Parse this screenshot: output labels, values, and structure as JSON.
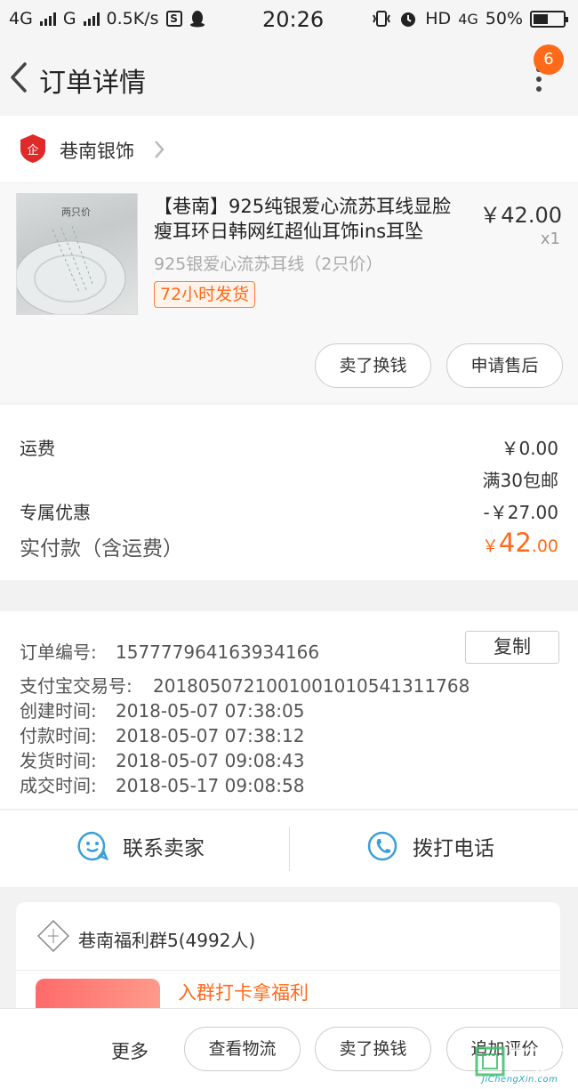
{
  "status_bar": {
    "network_1": "4G",
    "network_2": "G",
    "speed": "0.5K/s",
    "time": "20:26",
    "hd": "HD",
    "network_3": "4G",
    "battery": "50%",
    "battery_level": 0.5
  },
  "header": {
    "title": "订单详情",
    "badge_count": "6"
  },
  "shop": {
    "name": "巷南银饰"
  },
  "item": {
    "image_label": "两只价",
    "title": "【巷南】925纯银爱心流苏耳线显脸瘦耳环日韩网红超仙耳饰ins耳坠",
    "spec": "925银爱心流苏耳线（2只价）",
    "tag": "72小时发货",
    "price": "￥42.00",
    "qty": "x1",
    "buttons": [
      "卖了换钱",
      "申请售后"
    ]
  },
  "summary": {
    "shipping_label": "运费",
    "shipping_value": "￥0.00",
    "shipping_note": "满30包邮",
    "discount_label": "专属优惠",
    "discount_value": "-￥27.00",
    "paid_label": "实付款（含运费）",
    "paid_currency": "￥",
    "paid_int": "42",
    "paid_dec": ".00"
  },
  "order_info": {
    "copy_button": "复制",
    "rows": [
      {
        "label": "订单编号:",
        "value": "157777964163934166"
      },
      {
        "label": "支付宝交易号:",
        "value": "2018050721001001010541311768"
      },
      {
        "label": "创建时间:",
        "value": "2018-05-07 07:38:05"
      },
      {
        "label": "付款时间:",
        "value": "2018-05-07 07:38:12"
      },
      {
        "label": "发货时间:",
        "value": "2018-05-07 09:08:43"
      },
      {
        "label": "成交时间:",
        "value": "2018-05-17 09:08:58"
      }
    ]
  },
  "contact": {
    "seller": "联系卖家",
    "phone": "拨打电话"
  },
  "group": {
    "name": "巷南福利群5(4992人)",
    "promo": "入群打卡拿福利"
  },
  "bottom_bar": {
    "more": "更多",
    "buttons": [
      "查看物流",
      "卖了换钱",
      "追加评价"
    ]
  },
  "watermark": {
    "text": "JiChengXin.com"
  },
  "colors": {
    "accent": "#ff6a1a",
    "icon_blue": "#3aa0d8"
  }
}
